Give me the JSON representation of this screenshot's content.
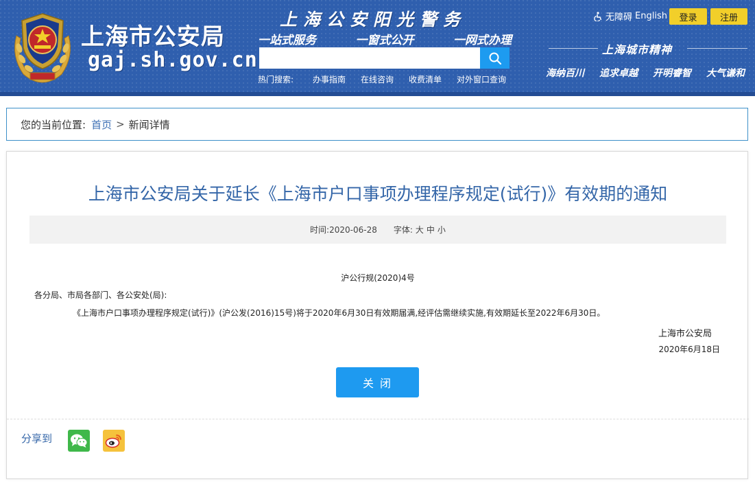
{
  "header": {
    "site_name": "上海市公安局",
    "site_domain": "gaj.sh.gov.cn",
    "slogan_title": "上海公安阳光警务",
    "slogan_items": [
      "一站式服务",
      "一窗式公开",
      "一网式办理"
    ],
    "search": {
      "value": "",
      "placeholder": "",
      "icon": "search-icon"
    },
    "hot_search_label": "热门搜索:",
    "hot_links": [
      "办事指南",
      "在线咨询",
      "收费清单",
      "对外窗口查询"
    ],
    "accessibility_label": "无障碍",
    "english_label": "English",
    "login_label": "登录",
    "register_label": "注册",
    "spirit_title": "上海城市精神",
    "spirit_items": [
      "海纳百川",
      "追求卓越",
      "开明睿智",
      "大气谦和"
    ],
    "colors": {
      "header_bg": "#2f5fae",
      "button_yellow": "#f2cf2a",
      "search_btn": "#1d9bf0"
    }
  },
  "breadcrumb": {
    "prefix": "您的当前位置:",
    "home": "首页",
    "separator": ">",
    "current": "新闻详情"
  },
  "article": {
    "title": "上海市公安局关于延长《上海市户口事项办理程序规定(试行)》有效期的通知",
    "time_label": "时间:",
    "time_value": "2020-06-28",
    "font_label": "字体:",
    "font_sizes": [
      "大",
      "中",
      "小"
    ],
    "doc_number": "沪公行规(2020)4号",
    "addressee": "各分局、市局各部门、各公安处(局):",
    "paragraph": "《上海市户口事项办理程序规定(试行)》(沪公发(2016)15号)将于2020年6月30日有效期届满,经评估需继续实施,有效期延长至2022年6月30日。",
    "signer": "上海市公安局",
    "sign_date": "2020年6月18日",
    "close_label": "关 闭"
  },
  "share": {
    "label": "分享到",
    "icons": [
      "wechat-icon",
      "weibo-icon"
    ]
  }
}
